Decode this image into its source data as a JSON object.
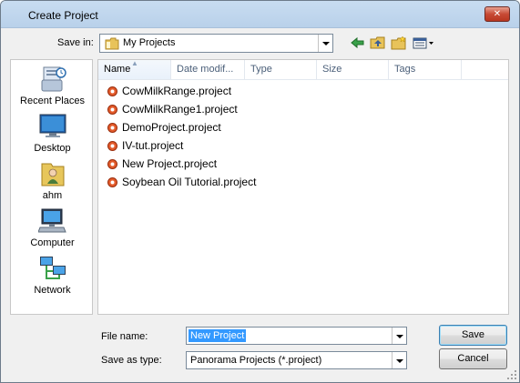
{
  "window": {
    "title": "Create Project",
    "close_label": "✕"
  },
  "toolbar": {
    "save_in_label": "Save in:",
    "location": "My Projects",
    "icons": [
      "back-arrow-icon",
      "up-folder-icon",
      "new-folder-icon",
      "view-menu-icon"
    ]
  },
  "places": [
    {
      "label": "Recent Places",
      "icon": "recent-places-icon"
    },
    {
      "label": "Desktop",
      "icon": "desktop-icon"
    },
    {
      "label": "ahm",
      "icon": "user-folder-icon"
    },
    {
      "label": "Computer",
      "icon": "computer-icon"
    },
    {
      "label": "Network",
      "icon": "network-icon"
    }
  ],
  "columns": [
    "Name",
    "Date modif...",
    "Type",
    "Size",
    "Tags"
  ],
  "files": [
    "CowMilkRange.project",
    "CowMilkRange1.project",
    "DemoProject.project",
    "IV-tut.project",
    "New Project.project",
    "Soybean Oil Tutorial.project"
  ],
  "form": {
    "file_name_label": "File name:",
    "file_name_value": "New Project",
    "save_as_type_label": "Save as type:",
    "save_as_type_value": "Panorama Projects (*.project)"
  },
  "buttons": {
    "save": "Save",
    "cancel": "Cancel"
  },
  "colors": {
    "selection": "#3399ff",
    "title_bar": "#c8dcf1",
    "close_button": "#c74a35"
  }
}
